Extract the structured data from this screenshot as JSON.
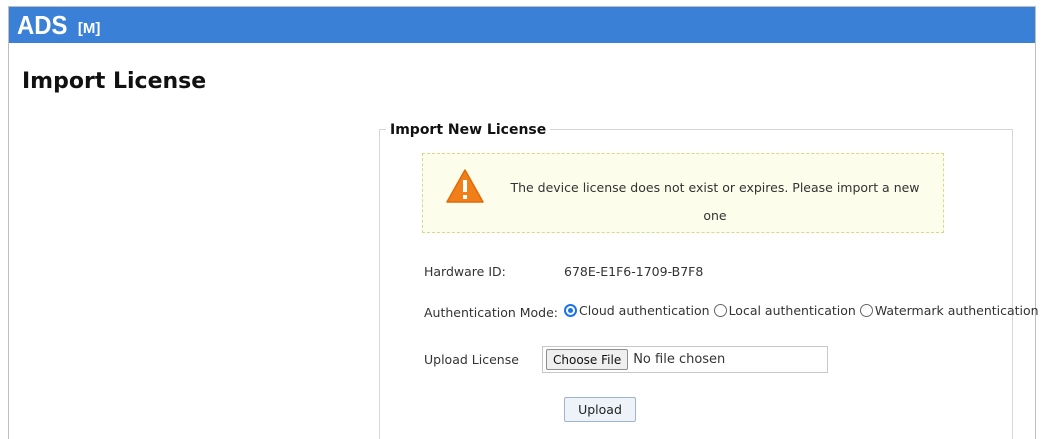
{
  "header": {
    "brand": "ADS",
    "brand_suffix": "[M]",
    "bar_color": "#3a80d6"
  },
  "page": {
    "title": "Import License"
  },
  "import_panel": {
    "legend": "Import New License",
    "alert": {
      "icon": "warning-icon",
      "message": "The device license does not exist or expires. Please import a new one"
    },
    "hardware_id": {
      "label": "Hardware ID:",
      "value": "678E-E1F6-1709-B7F8"
    },
    "authentication_mode": {
      "label": "Authentication Mode:",
      "options": [
        {
          "label": "Cloud authentication",
          "selected": true
        },
        {
          "label": "Local authentication",
          "selected": false
        },
        {
          "label": "Watermark authentication",
          "selected": false
        }
      ]
    },
    "upload_license": {
      "label": "Upload License",
      "choose_button": "Choose File",
      "file_status": "No file chosen"
    },
    "upload_button": "Upload"
  }
}
